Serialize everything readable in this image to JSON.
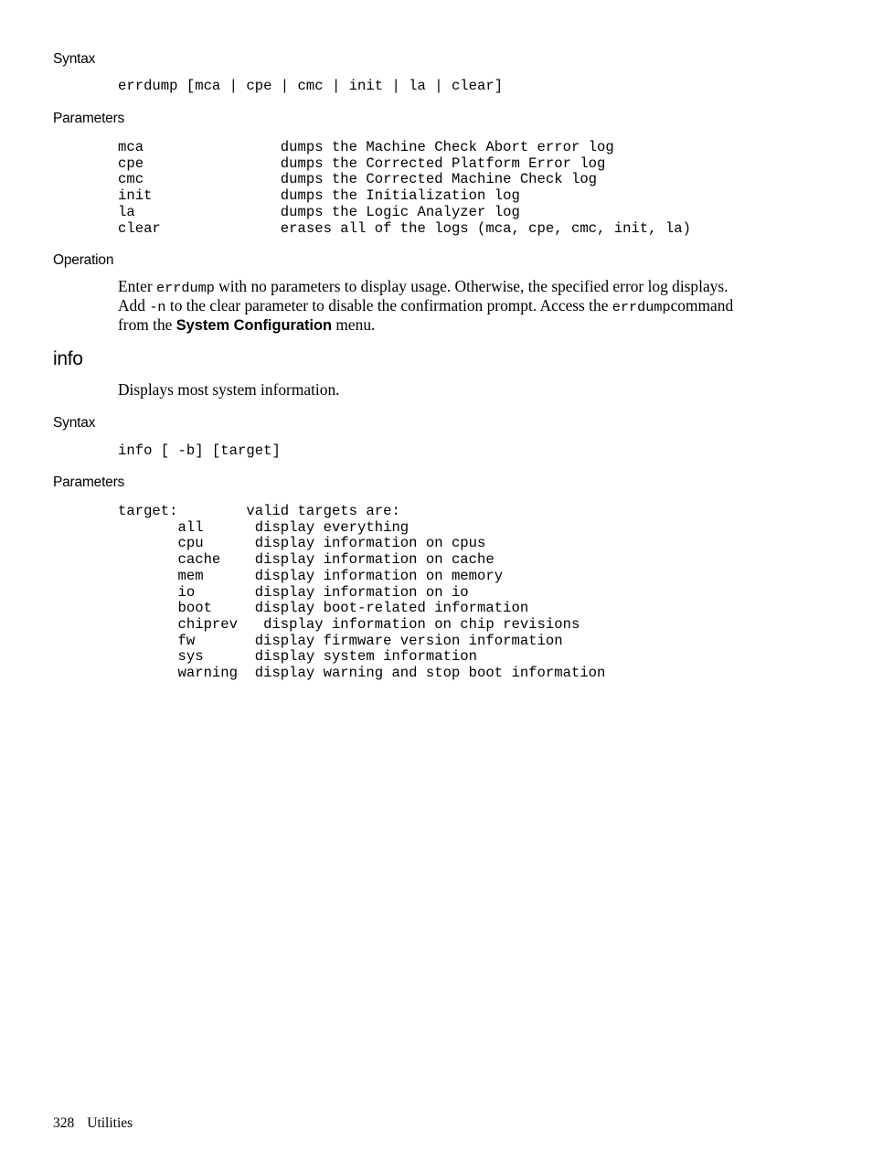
{
  "page": {
    "footer_page_number": "328",
    "footer_chapter": "Utilities"
  },
  "errdump_section": {
    "syntax_heading": "Syntax",
    "syntax_code": "errdump [mca | cpe | cmc | init | la | clear]",
    "parameters_heading": "Parameters",
    "parameters_block": "mca                dumps the Machine Check Abort error log\ncpe                dumps the Corrected Platform Error log\ncmc                dumps the Corrected Machine Check log\ninit               dumps the Initialization log\nla                 dumps the Logic Analyzer log\nclear              erases all of the logs (mca, cpe, cmc, init, la)",
    "parameters": [
      {
        "name": "mca",
        "description": "dumps the Machine Check Abort error log"
      },
      {
        "name": "cpe",
        "description": "dumps the Corrected Platform Error log"
      },
      {
        "name": "cmc",
        "description": "dumps the Corrected Machine Check log"
      },
      {
        "name": "init",
        "description": "dumps the Initialization log"
      },
      {
        "name": "la",
        "description": "dumps the Logic Analyzer log"
      },
      {
        "name": "clear",
        "description": "erases all of the logs (mca, cpe, cmc, init, la)"
      }
    ],
    "operation_heading": "Operation",
    "operation_line1_a": "Enter ",
    "operation_line1_mono": "errdump",
    "operation_line1_b": " with no parameters to display usage. Otherwise, the specified error log displays.",
    "operation_line2_a": "Add ",
    "operation_line2_mono": "-n",
    "operation_line2_b": " to the clear parameter to disable the confirmation prompt. Access the ",
    "operation_line2_mono2": "errdump",
    "operation_line2_c": "command",
    "operation_line3_a": "from the ",
    "operation_line3_bold": "System Configuration",
    "operation_line3_b": " menu."
  },
  "info_section": {
    "title": "info",
    "description": "Displays most system information.",
    "syntax_heading": "Syntax",
    "syntax_code": "info [ -b] [target]",
    "parameters_heading": "Parameters",
    "parameters_block": "target:        valid targets are:\n       all      display everything\n       cpu      display information on cpus\n       cache    display information on cache\n       mem      display information on memory\n       io       display information on io\n       boot     display boot-related information\n       chiprev   display information on chip revisions\n       fw       display firmware version information\n       sys      display system information\n       warning  display warning and stop boot information",
    "target_label": "target:",
    "target_header": "valid targets are:",
    "targets": [
      {
        "name": "all",
        "description": "display everything"
      },
      {
        "name": "cpu",
        "description": "display information on cpus"
      },
      {
        "name": "cache",
        "description": "display information on cache"
      },
      {
        "name": "mem",
        "description": "display information on memory"
      },
      {
        "name": "io",
        "description": "display information on io"
      },
      {
        "name": "boot",
        "description": "display boot-related information"
      },
      {
        "name": "chiprev",
        "description": "display information on chip revisions"
      },
      {
        "name": "fw",
        "description": "display firmware version information"
      },
      {
        "name": "sys",
        "description": "display system information"
      },
      {
        "name": "warning",
        "description": "display warning and stop boot information"
      }
    ]
  }
}
